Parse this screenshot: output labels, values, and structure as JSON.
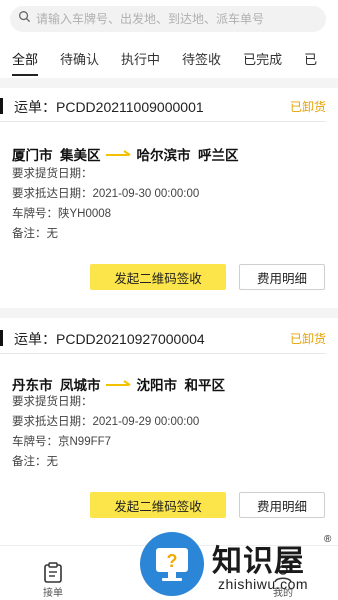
{
  "search": {
    "placeholder": "请输入车牌号、出发地、到达地、派车单号",
    "icon": "search-icon"
  },
  "tabs": [
    {
      "label": "全部",
      "active": true
    },
    {
      "label": "待确认"
    },
    {
      "label": "执行中"
    },
    {
      "label": "待签收"
    },
    {
      "label": "已完成"
    },
    {
      "label": "已"
    }
  ],
  "orders": [
    {
      "waybill": "运单：PCDD20211009000001",
      "status": "已卸货",
      "from_city": "厦门市",
      "from_district": "集美区",
      "to_city": "哈尔滨市",
      "to_district": "呼兰区",
      "pickup_date": "要求提货日期：",
      "arrive_date": "要求抵达日期：2021-09-30 00:00:00",
      "plate": "车牌号：陕YH0008",
      "remark": "备注：无",
      "qr_button": "发起二维码签收",
      "fee_button": "费用明细"
    },
    {
      "waybill": "运单：PCDD20210927000004",
      "status": "已卸货",
      "from_city": "丹东市",
      "from_district": "凤城市",
      "to_city": "沈阳市",
      "to_district": "和平区",
      "pickup_date": "要求提货日期：",
      "arrive_date": "要求抵达日期：2021-09-29 00:00:00",
      "plate": "车牌号：京N99FF7",
      "remark": "备注：无",
      "qr_button": "发起二维码签收",
      "fee_button": "费用明细"
    }
  ],
  "nav": {
    "orders_label": "接单",
    "mine_label": "我的"
  },
  "watermark": {
    "brand": "知识屋",
    "domain": "zhishiwu.com",
    "reg": "®"
  },
  "colors": {
    "accent_yellow": "#fbe54a",
    "status_orange": "#e6a100",
    "watermark_blue": "#2c86d8"
  }
}
